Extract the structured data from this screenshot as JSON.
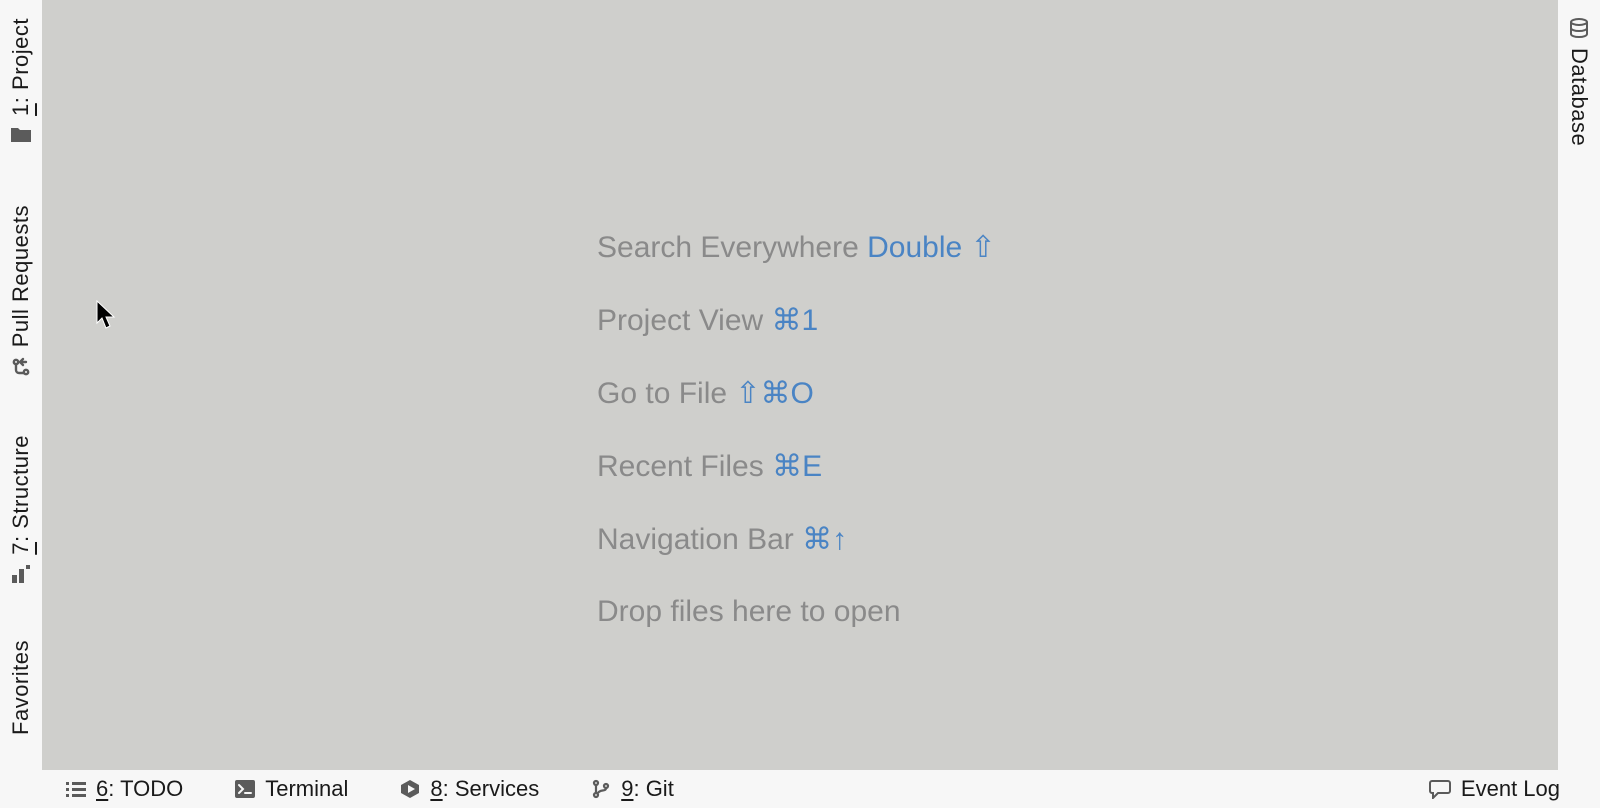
{
  "left_stripe": {
    "project": {
      "label": "1: Project"
    },
    "pull_requests": {
      "label": "Pull Requests"
    },
    "structure": {
      "label": "7: Structure"
    },
    "favorites": {
      "label": "Favorites"
    }
  },
  "right_stripe": {
    "database": {
      "label": "Database"
    }
  },
  "hints": {
    "search_everywhere": {
      "label": "Search Everywhere",
      "shortcut": "Double ⇧"
    },
    "project_view": {
      "label": "Project View",
      "shortcut": "⌘1"
    },
    "go_to_file": {
      "label": "Go to File",
      "shortcut": "⇧⌘O"
    },
    "recent_files": {
      "label": "Recent Files",
      "shortcut": "⌘E"
    },
    "navigation_bar": {
      "label": "Navigation Bar",
      "shortcut": "⌘↑"
    },
    "drop_hint": {
      "label": "Drop files here to open"
    }
  },
  "bottom_bar": {
    "todo": {
      "num": "6",
      "label": ": TODO"
    },
    "terminal": {
      "label": "Terminal"
    },
    "services": {
      "num": "8",
      "label": ": Services"
    },
    "git": {
      "num": "9",
      "label": ": Git"
    },
    "event_log": {
      "label": "Event Log"
    }
  }
}
